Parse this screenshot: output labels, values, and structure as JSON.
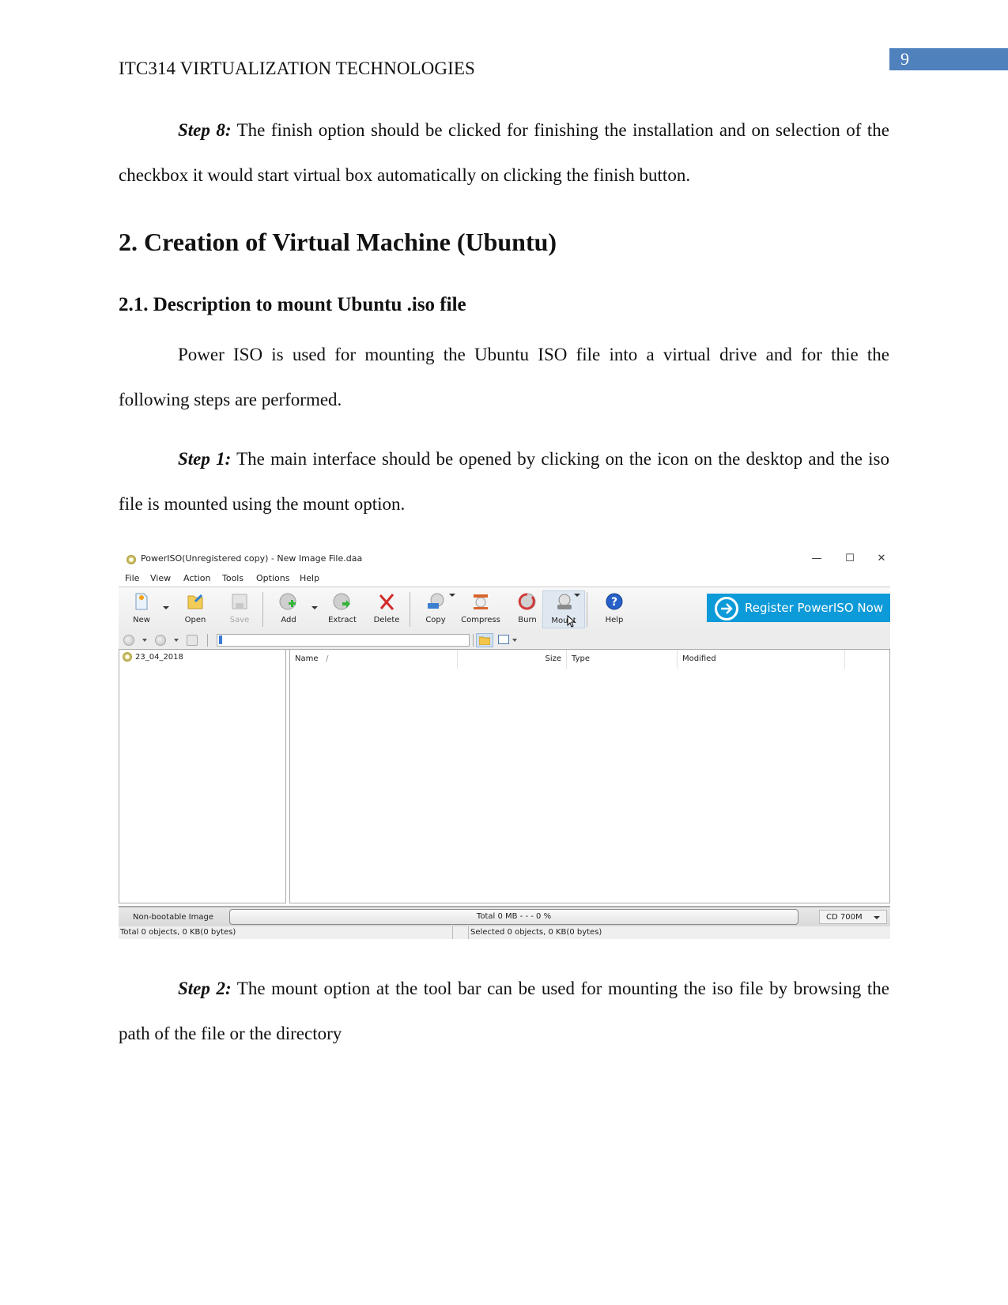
{
  "header": {
    "running_title": "ITC314 VIRTUALIZATION TECHNOLOGIES",
    "page_number": "9",
    "page_number_color": "#4f81bd"
  },
  "body": {
    "step8": {
      "label": "Step 8:",
      "text": " The finish option should be clicked for finishing the installation and on selection of the checkbox it would start virtual box automatically on clicking the finish button."
    },
    "heading_1": "2. Creation of Virtual Machine (Ubuntu)",
    "heading_2": "2.1. Description to mount Ubuntu .iso file",
    "intro": "Power ISO is used for mounting the Ubuntu ISO file into a virtual drive and for thie the following steps are performed.",
    "step1": {
      "label": "Step 1:",
      "text": " The main interface should be opened by clicking on the icon on the desktop and the iso file is mounted using the mount option."
    },
    "step2": {
      "label": "Step 2:",
      "text": " The mount option at the tool bar can be used for mounting the iso file by browsing the path of the file or the directory"
    }
  },
  "screenshot": {
    "window_title": "PowerISO(Unregistered copy) - New Image File.daa",
    "window_controls": {
      "minimize": "—",
      "maximize": "☐",
      "close": "✕"
    },
    "menu": [
      "File",
      "View",
      "Action",
      "Tools",
      "Options",
      "Help"
    ],
    "toolbar": [
      {
        "label": "New",
        "icon": "new-file-icon"
      },
      {
        "label": "Open",
        "icon": "open-folder-icon"
      },
      {
        "label": "Save",
        "icon": "save-disk-icon",
        "disabled": true
      },
      {
        "label": "Add",
        "icon": "add-disc-icon"
      },
      {
        "label": "Extract",
        "icon": "extract-disc-icon"
      },
      {
        "label": "Delete",
        "icon": "delete-x-icon"
      },
      {
        "label": "Copy",
        "icon": "copy-disc-icon"
      },
      {
        "label": "Compress",
        "icon": "compress-icon"
      },
      {
        "label": "Burn",
        "icon": "burn-disc-icon"
      },
      {
        "label": "Mount",
        "icon": "mount-drive-icon",
        "hovered": true
      },
      {
        "label": "Help",
        "icon": "help-icon"
      }
    ],
    "register_button": "Register PowerISO Now",
    "register_color": "#0d9ad8",
    "path_value": "\\",
    "tree": [
      "23_04_2018"
    ],
    "columns": [
      "Name",
      "Size",
      "Type",
      "Modified"
    ],
    "name_sort_indicator": "/",
    "status": {
      "boot": "Non-bootable Image",
      "progress_text": "Total  0 MB   - - -  0 %",
      "capacity": "CD 700M",
      "total_objects": "Total 0 objects, 0 KB(0 bytes)",
      "selected_objects": "Selected 0 objects, 0 KB(0 bytes)"
    }
  }
}
